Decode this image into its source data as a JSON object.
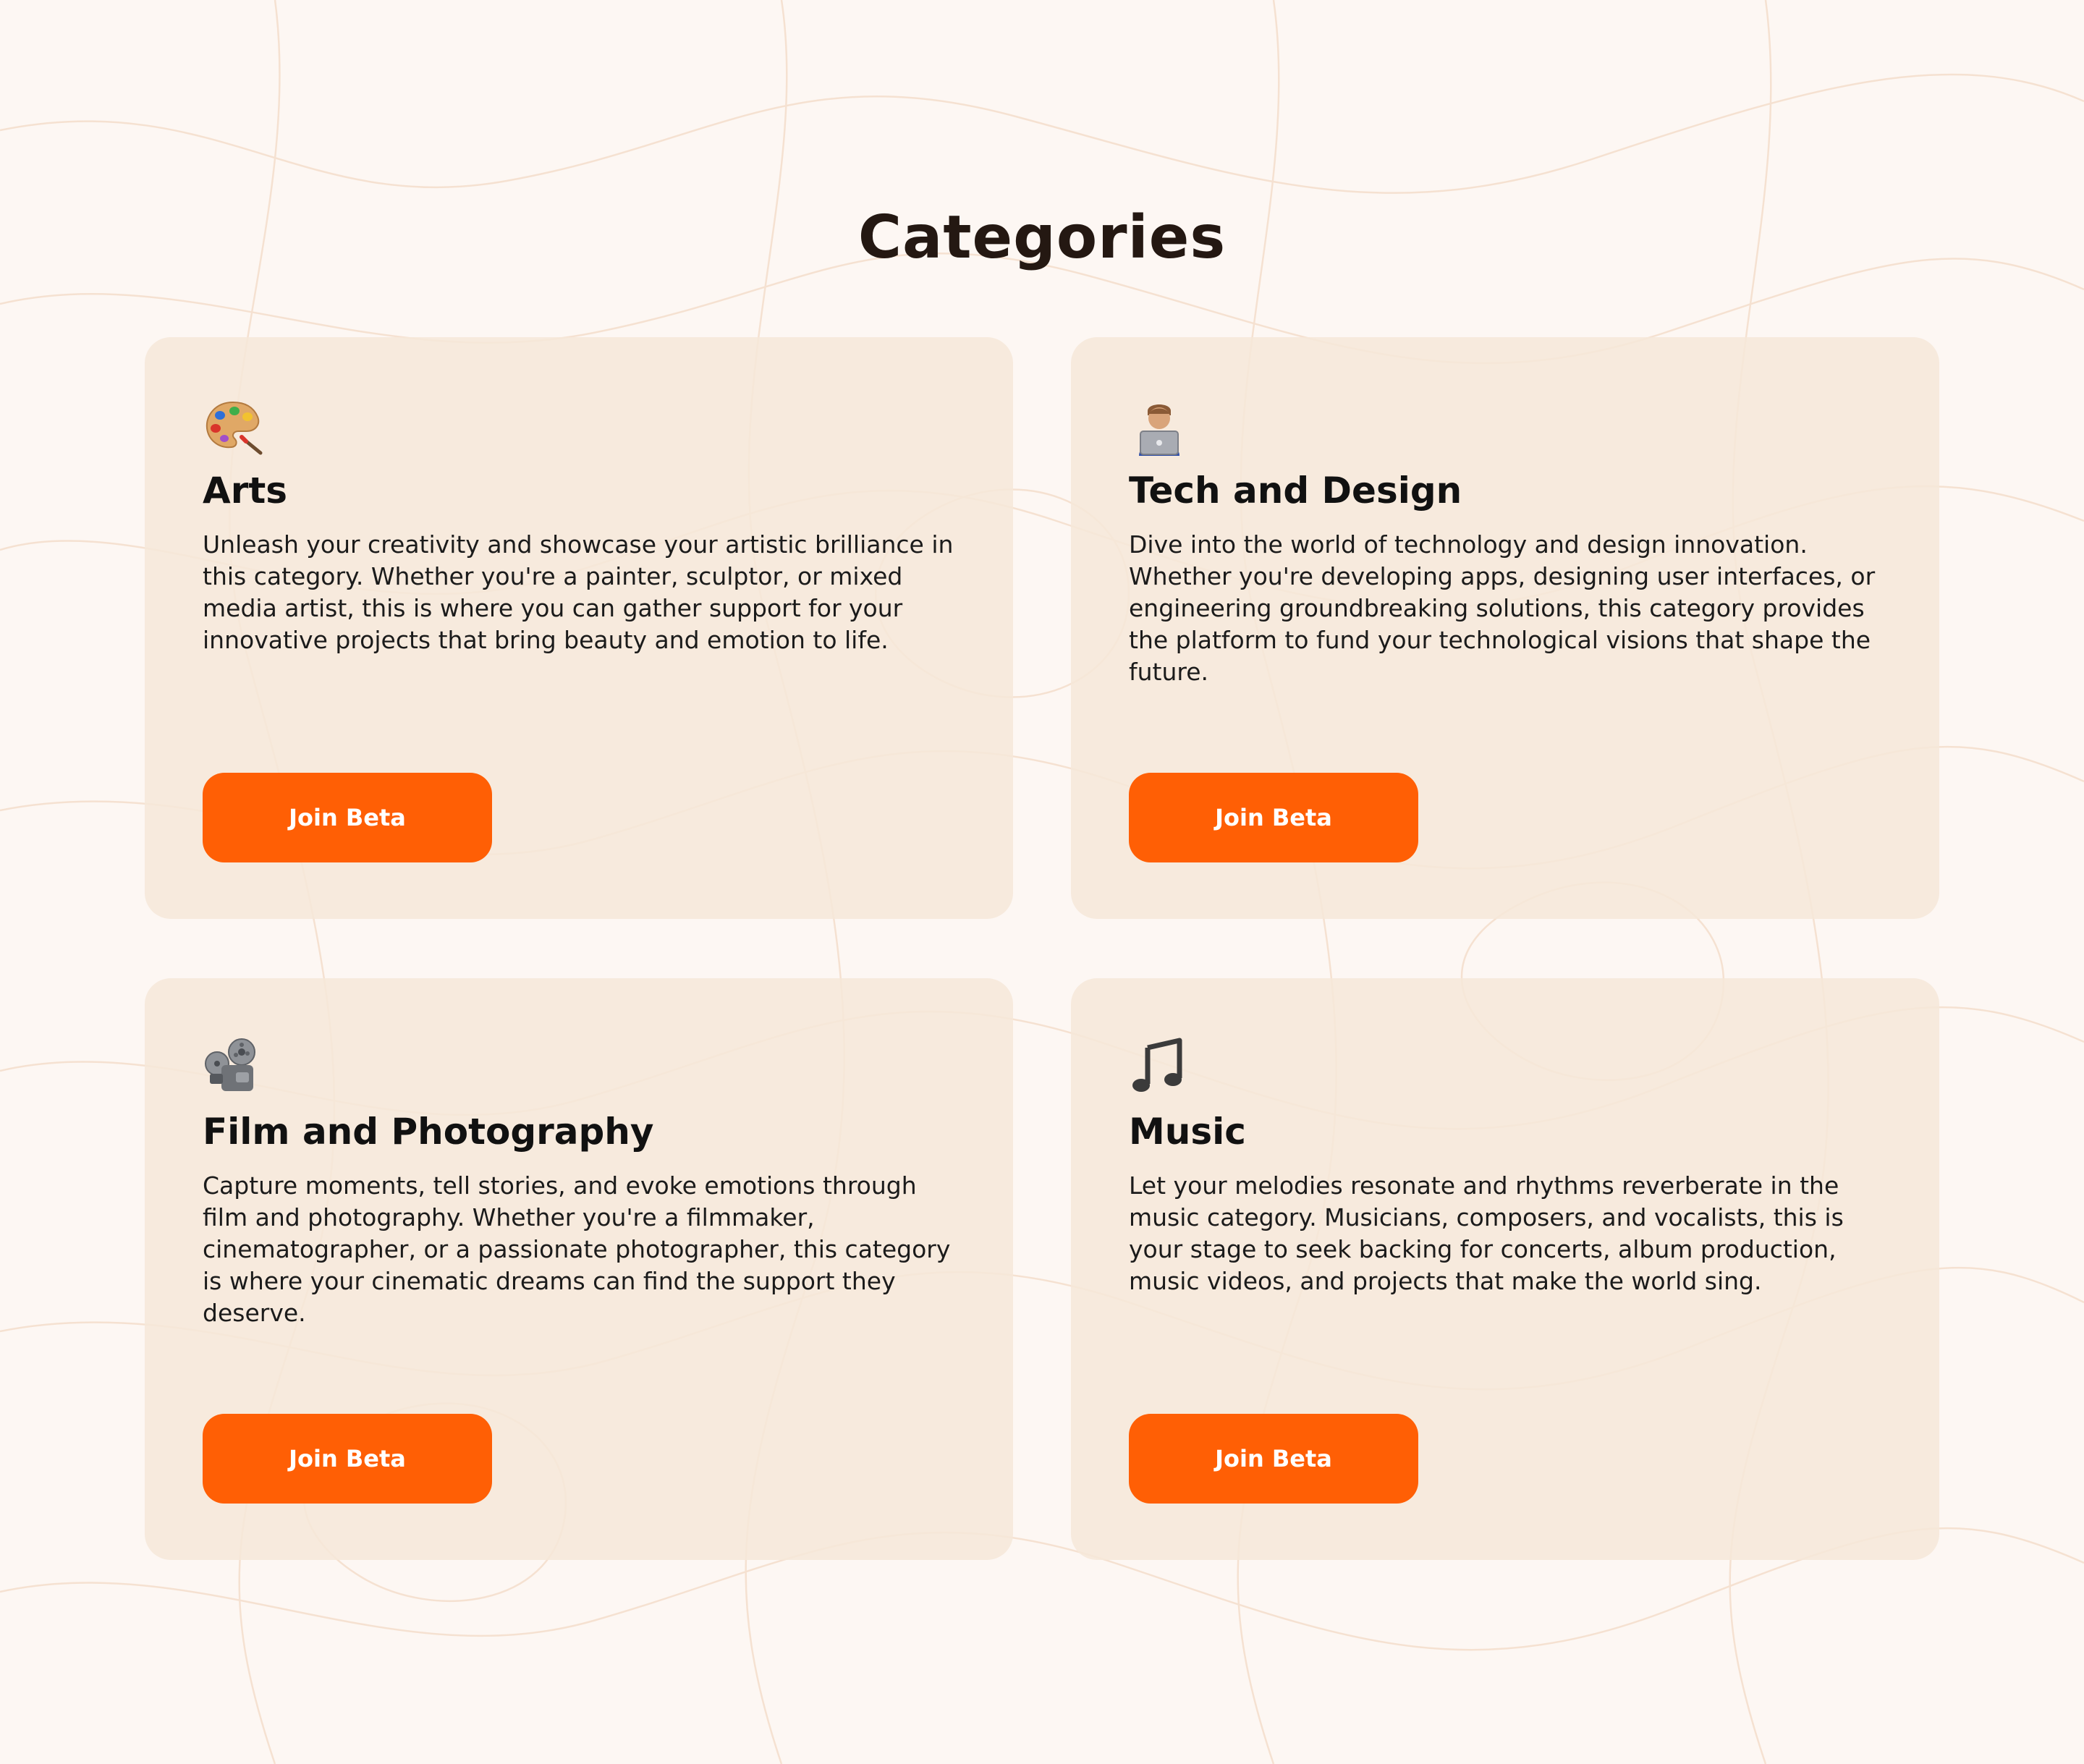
{
  "section": {
    "title": "Categories"
  },
  "categories": [
    {
      "icon": "artist-palette-icon",
      "title": "Arts",
      "description": "Unleash your creativity and showcase your artistic brilliance in this category. Whether you're a painter, sculptor, or mixed media artist, this is where you can gather support for your innovative projects that bring beauty and emotion to life.",
      "button_label": "Join Beta"
    },
    {
      "icon": "technologist-icon",
      "title": "Tech and Design",
      "description": "Dive into the world of technology and design innovation. Whether you're developing apps, designing user interfaces, or engineering groundbreaking solutions, this category provides the platform to fund your technological visions that shape the future.",
      "button_label": "Join Beta"
    },
    {
      "icon": "film-projector-icon",
      "title": "Film and Photography",
      "description": "Capture moments, tell stories, and evoke emotions through film and photography. Whether you're a filmmaker, cinematographer, or a passionate photographer, this category is where your cinematic dreams can find the support they deserve.",
      "button_label": "Join Beta"
    },
    {
      "icon": "musical-note-icon",
      "title": "Music",
      "description": "Let your melodies resonate and rhythms reverberate in the music category. Musicians, composers, and vocalists, this is your stage to seek backing for concerts, album production, music videos, and projects that make the world sing.",
      "button_label": "Join Beta"
    }
  ],
  "colors": {
    "background": "#fdf7f3",
    "card": "#f6e8d9",
    "accent": "#ff5f05",
    "title": "#241812"
  }
}
